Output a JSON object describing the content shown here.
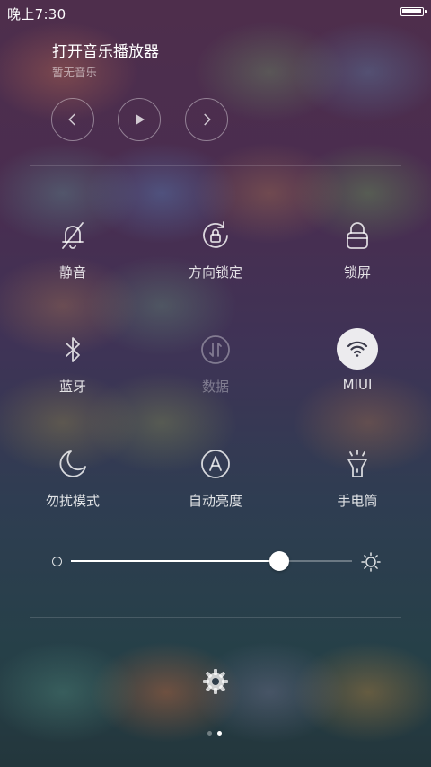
{
  "status": {
    "time": "晚上7:30",
    "battery_level": 1.0
  },
  "music": {
    "title": "打开音乐播放器",
    "subtitle": "暂无音乐"
  },
  "toggles": [
    {
      "label": "静音",
      "icon": "bell-off-icon",
      "state": "off"
    },
    {
      "label": "方向锁定",
      "icon": "rotation-lock-icon",
      "state": "off"
    },
    {
      "label": "锁屏",
      "icon": "lock-icon",
      "state": "off"
    },
    {
      "label": "蓝牙",
      "icon": "bluetooth-icon",
      "state": "off"
    },
    {
      "label": "数据",
      "icon": "mobile-data-icon",
      "state": "disabled"
    },
    {
      "label": "MIUI",
      "icon": "wifi-icon",
      "state": "on"
    },
    {
      "label": "勿扰模式",
      "icon": "moon-icon",
      "state": "off"
    },
    {
      "label": "自动亮度",
      "icon": "auto-brightness-icon",
      "state": "off"
    },
    {
      "label": "手电筒",
      "icon": "flashlight-icon",
      "state": "off"
    }
  ],
  "brightness": {
    "level": 0.74
  },
  "pager": {
    "pages": 2,
    "current": 2
  },
  "colors": {
    "active_bg": "#ffffff",
    "active_icon": "#3a3a4a",
    "text": "#ffffff"
  }
}
